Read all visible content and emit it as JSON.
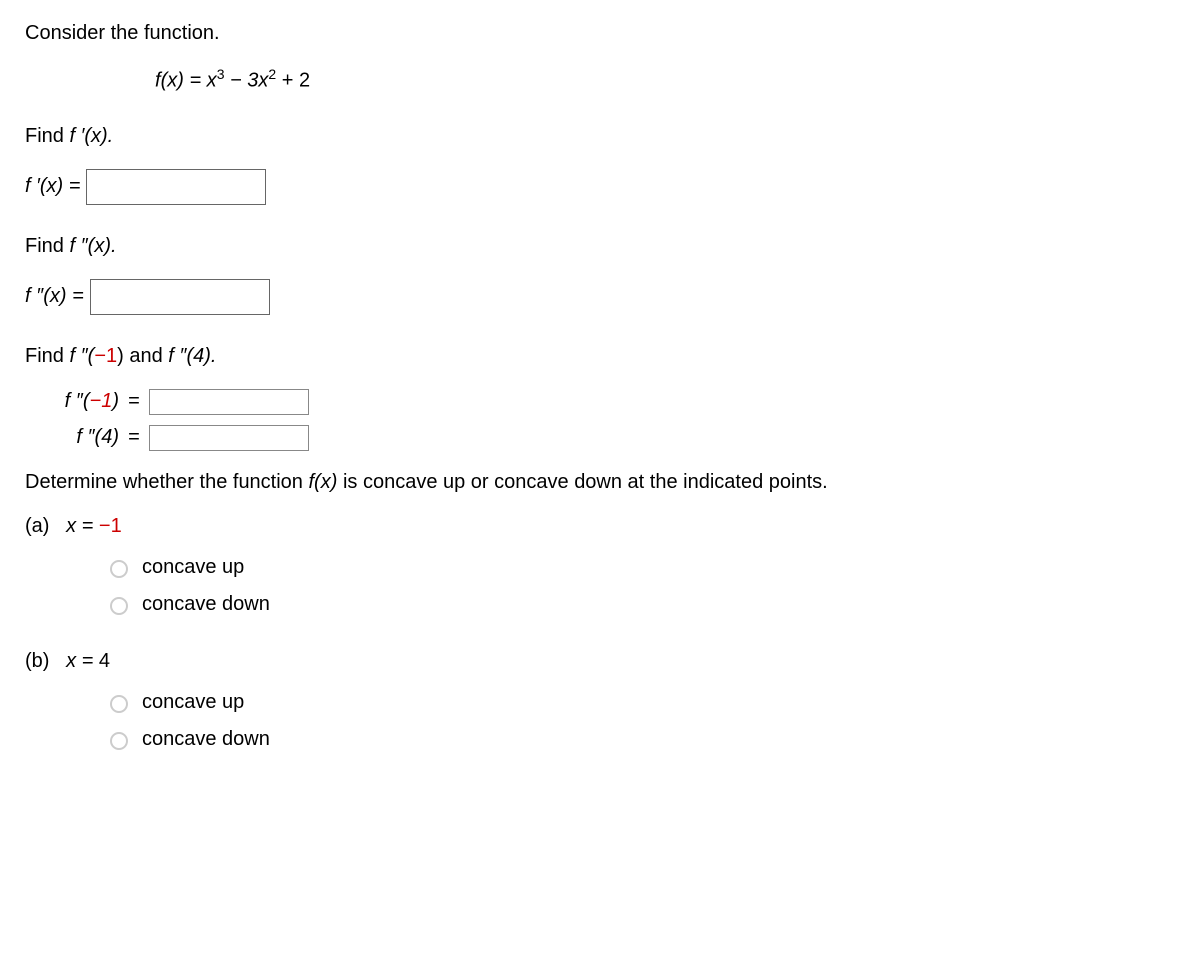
{
  "intro": "Consider the function.",
  "formula": {
    "pre": "f",
    "arg": "(x) = x",
    "exp1": "3",
    "mid": " − 3x",
    "exp2": "2",
    "end": " + 2"
  },
  "q1": {
    "prompt_pre": "Find ",
    "prompt_fx": "f ′(x).",
    "label": "f ′(x) = "
  },
  "q2": {
    "prompt_pre": "Find ",
    "prompt_fx": "f ″(x).",
    "label": "f ″(x) = "
  },
  "q3": {
    "prompt_pre": "Find ",
    "prompt_a": "f ″(",
    "prompt_neg1": "−1",
    "prompt_mid": ") and ",
    "prompt_b": "f ″(4).",
    "row1_label": "f ″(−1)",
    "row2_label": "f ″(4)",
    "eq": "="
  },
  "q4": {
    "prompt_pre": "Determine whether the function ",
    "prompt_fx": "f(x)",
    "prompt_post": " is concave up or concave down at the indicated points."
  },
  "parts": {
    "a": {
      "label": "(a)",
      "x_pre": "x = ",
      "x_val": "−1",
      "opt1": "concave up",
      "opt2": "concave down"
    },
    "b": {
      "label": "(b)",
      "x_pre": "x = ",
      "x_val": "4",
      "opt1": "concave up",
      "opt2": "concave down"
    }
  }
}
